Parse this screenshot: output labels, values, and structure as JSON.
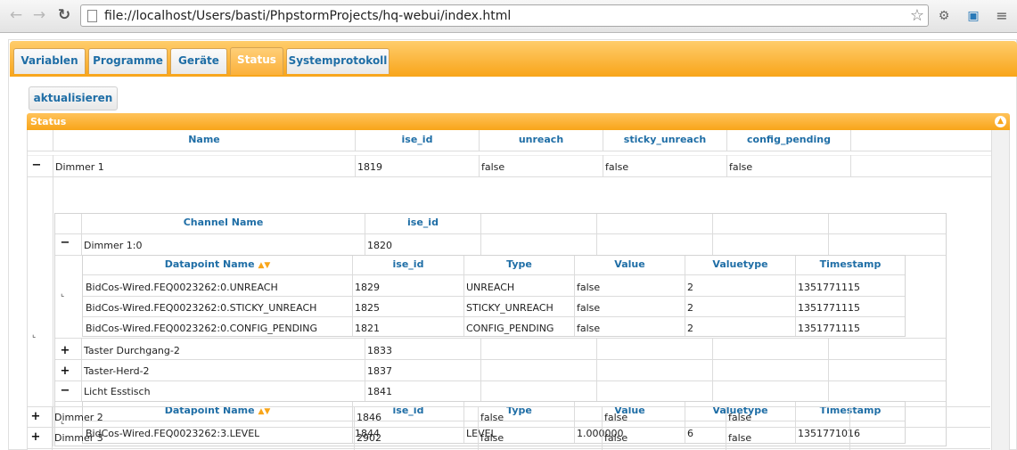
{
  "browser": {
    "url": "file://localhost/Users/basti/PhpstormProjects/hq-webui/index.html"
  },
  "tabs": [
    {
      "label": "Variablen"
    },
    {
      "label": "Programme"
    },
    {
      "label": "Geräte"
    },
    {
      "label": "Status",
      "active": true
    },
    {
      "label": "Systemprotokoll"
    }
  ],
  "toolbar": {
    "refresh_label": "aktualisieren"
  },
  "panel": {
    "title": "Status"
  },
  "main_table": {
    "columns": [
      "Name",
      "ise_id",
      "unreach",
      "sticky_unreach",
      "config_pending"
    ],
    "rows": [
      {
        "expander": "−",
        "name": "Dimmer 1",
        "ise_id": "1819",
        "unreach": "false",
        "sticky_unreach": "false",
        "config_pending": "false"
      },
      {
        "expander": "+",
        "name": "Dimmer 2",
        "ise_id": "1846",
        "unreach": "false",
        "sticky_unreach": "false",
        "config_pending": "false"
      },
      {
        "expander": "+",
        "name": "Dimmer 3",
        "ise_id": "2902",
        "unreach": "false",
        "sticky_unreach": "false",
        "config_pending": "false"
      }
    ]
  },
  "channel_table": {
    "columns": [
      "Channel Name",
      "ise_id"
    ],
    "rows": [
      {
        "expander": "−",
        "name": "Dimmer 1:0",
        "ise_id": "1820"
      },
      {
        "expander": "+",
        "name": "Taster Durchgang-2",
        "ise_id": "1833"
      },
      {
        "expander": "+",
        "name": "Taster-Herd-2",
        "ise_id": "1837"
      },
      {
        "expander": "−",
        "name": "Licht Esstisch",
        "ise_id": "1841"
      }
    ]
  },
  "datapoint_columns": [
    "Datapoint Name",
    "ise_id",
    "Type",
    "Value",
    "Valuetype",
    "Timestamp"
  ],
  "datapoint_sort_icon": "▲▼",
  "datapoints_1": [
    {
      "name": "BidCos-Wired.FEQ0023262:0.UNREACH",
      "ise_id": "1829",
      "type": "UNREACH",
      "value": "false",
      "valuetype": "2",
      "timestamp": "1351771115"
    },
    {
      "name": "BidCos-Wired.FEQ0023262:0.STICKY_UNREACH",
      "ise_id": "1825",
      "type": "STICKY_UNREACH",
      "value": "false",
      "valuetype": "2",
      "timestamp": "1351771115"
    },
    {
      "name": "BidCos-Wired.FEQ0023262:0.CONFIG_PENDING",
      "ise_id": "1821",
      "type": "CONFIG_PENDING",
      "value": "false",
      "valuetype": "2",
      "timestamp": "1351771115"
    }
  ],
  "datapoints_2": [
    {
      "name": "BidCos-Wired.FEQ0023262:3.LEVEL",
      "ise_id": "1844",
      "type": "LEVEL",
      "value": "1.000000",
      "valuetype": "6",
      "timestamp": "1351771016"
    }
  ],
  "colors": {
    "accent": "#f8a519",
    "header_text": "#1f6ea6"
  }
}
